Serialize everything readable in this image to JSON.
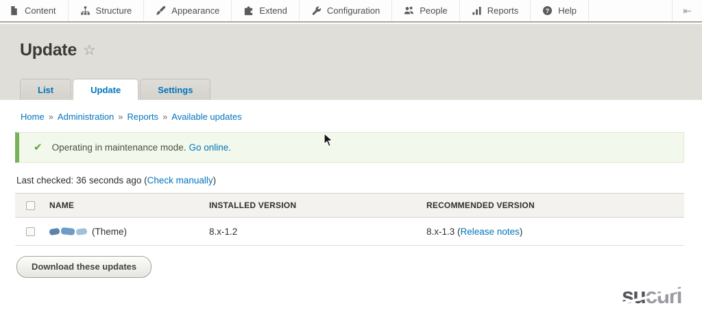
{
  "toolbar": {
    "items": [
      {
        "label": "Content"
      },
      {
        "label": "Structure"
      },
      {
        "label": "Appearance"
      },
      {
        "label": "Extend"
      },
      {
        "label": "Configuration"
      },
      {
        "label": "People"
      },
      {
        "label": "Reports"
      },
      {
        "label": "Help"
      }
    ],
    "collapse_glyph": "⇤"
  },
  "page": {
    "title": "Update",
    "star_glyph": "☆"
  },
  "tabs": [
    {
      "label": "List"
    },
    {
      "label": "Update"
    },
    {
      "label": "Settings"
    }
  ],
  "breadcrumb": {
    "separator": "»",
    "items": [
      "Home",
      "Administration",
      "Reports",
      "Available updates"
    ]
  },
  "status": {
    "check_glyph": "✔",
    "message": "Operating in maintenance mode.",
    "link": "Go online."
  },
  "last_checked": {
    "prefix": "Last checked: 36 seconds ago (",
    "link": "Check manually",
    "suffix": ")"
  },
  "updates_table": {
    "headers": {
      "name": "NAME",
      "installed": "INSTALLED VERSION",
      "recommended": "RECOMMENDED VERSION"
    },
    "rows": [
      {
        "name_redacted": true,
        "name_suffix": "(Theme)",
        "installed": "8.x-1.2",
        "recommended_prefix": "8.x-1.3 (",
        "recommended_link": "Release notes",
        "recommended_suffix": ")"
      }
    ]
  },
  "actions": {
    "download_button": "Download these updates"
  },
  "branding": {
    "logo_part1": "su",
    "logo_part2": "curi"
  },
  "colors": {
    "link_blue": "#0074bd",
    "status_green": "#77b259",
    "header_beige": "#e0ded8"
  }
}
